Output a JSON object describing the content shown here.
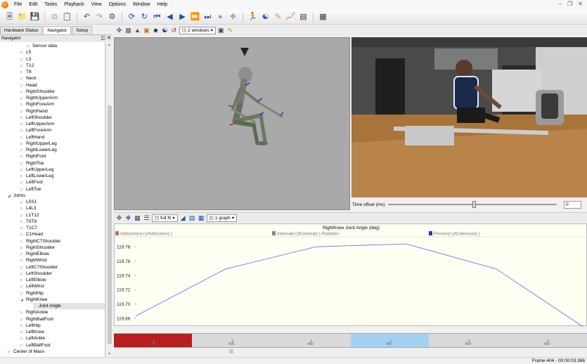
{
  "menu": [
    "File",
    "Edit",
    "Tasks",
    "Playback",
    "View",
    "Options",
    "Window",
    "Help"
  ],
  "left_tabs": [
    "Hardware Status",
    "Navigator",
    "Setup"
  ],
  "navigator_title": "Navigator",
  "tree": [
    {
      "label": "Sensor data",
      "indent": 4,
      "toggle": "▷"
    },
    {
      "label": "L5",
      "indent": 3,
      "toggle": "▷"
    },
    {
      "label": "L3",
      "indent": 3,
      "toggle": "▷"
    },
    {
      "label": "T12",
      "indent": 3,
      "toggle": "▷"
    },
    {
      "label": "T8",
      "indent": 3,
      "toggle": "▷"
    },
    {
      "label": "Neck",
      "indent": 3,
      "toggle": "▷"
    },
    {
      "label": "Head",
      "indent": 3,
      "toggle": "▷"
    },
    {
      "label": "RightShoulder",
      "indent": 3,
      "toggle": "▷"
    },
    {
      "label": "RightUpperArm",
      "indent": 3,
      "toggle": "▷"
    },
    {
      "label": "RightForeArm",
      "indent": 3,
      "toggle": "▷"
    },
    {
      "label": "RightHand",
      "indent": 3,
      "toggle": "▷"
    },
    {
      "label": "LeftShoulder",
      "indent": 3,
      "toggle": "▷"
    },
    {
      "label": "LeftUpperArm",
      "indent": 3,
      "toggle": "▷"
    },
    {
      "label": "LeftForeArm",
      "indent": 3,
      "toggle": "▷"
    },
    {
      "label": "LeftHand",
      "indent": 3,
      "toggle": "▷"
    },
    {
      "label": "RightUpperLeg",
      "indent": 3,
      "toggle": "▷"
    },
    {
      "label": "RightLowerLeg",
      "indent": 3,
      "toggle": "▷"
    },
    {
      "label": "RightFoot",
      "indent": 3,
      "toggle": "▷"
    },
    {
      "label": "RightToe",
      "indent": 3,
      "toggle": "▷"
    },
    {
      "label": "LeftUpperLeg",
      "indent": 3,
      "toggle": "▷"
    },
    {
      "label": "LeftLowerLeg",
      "indent": 3,
      "toggle": "▷"
    },
    {
      "label": "LeftFoot",
      "indent": 3,
      "toggle": "▷"
    },
    {
      "label": "LeftToe",
      "indent": 3,
      "toggle": "▷"
    },
    {
      "label": "Joints",
      "indent": 1,
      "toggle": "◢"
    },
    {
      "label": "L5S1",
      "indent": 3,
      "toggle": "▷"
    },
    {
      "label": "L4L3",
      "indent": 3,
      "toggle": "▷"
    },
    {
      "label": "L1T12",
      "indent": 3,
      "toggle": "▷"
    },
    {
      "label": "T9T8",
      "indent": 3,
      "toggle": "▷"
    },
    {
      "label": "T1C7",
      "indent": 3,
      "toggle": "▷"
    },
    {
      "label": "C1Head",
      "indent": 3,
      "toggle": "▷"
    },
    {
      "label": "RightC7Shoulder",
      "indent": 3,
      "toggle": "▷"
    },
    {
      "label": "RightShoulder",
      "indent": 3,
      "toggle": "▷"
    },
    {
      "label": "RightElbow",
      "indent": 3,
      "toggle": "▷"
    },
    {
      "label": "RightWrist",
      "indent": 3,
      "toggle": "▷"
    },
    {
      "label": "LeftC7Shoulder",
      "indent": 3,
      "toggle": "▷"
    },
    {
      "label": "LeftShoulder",
      "indent": 3,
      "toggle": "▷"
    },
    {
      "label": "LeftElbow",
      "indent": 3,
      "toggle": "▷"
    },
    {
      "label": "LeftWrist",
      "indent": 3,
      "toggle": "▷"
    },
    {
      "label": "RightHip",
      "indent": 3,
      "toggle": "▷"
    },
    {
      "label": "RightKnee",
      "indent": 3,
      "toggle": "◢"
    },
    {
      "label": "Joint Angle",
      "indent": 5,
      "toggle": "",
      "selected": true
    },
    {
      "label": "RightAnkle",
      "indent": 3,
      "toggle": "▷"
    },
    {
      "label": "RightBallFoot",
      "indent": 3,
      "toggle": "▷"
    },
    {
      "label": "LeftHip",
      "indent": 3,
      "toggle": "▷"
    },
    {
      "label": "LeftKnee",
      "indent": 3,
      "toggle": "▷"
    },
    {
      "label": "LeftAnkle",
      "indent": 3,
      "toggle": "▷"
    },
    {
      "label": "LeftBallFoot",
      "indent": 3,
      "toggle": "▷"
    },
    {
      "label": "Center of Mass",
      "indent": 1,
      "toggle": "▷"
    }
  ],
  "view_toolbar": {
    "windows_dropdown": "2 windows"
  },
  "video": {
    "time_offset_label": "Time offset (ms)",
    "time_offset_value": "0"
  },
  "graph_toolbar": {
    "fit_dropdown": "full fit",
    "graph_count_dropdown": "1 graph"
  },
  "chart_data": {
    "type": "line",
    "title": "RightKnee Joint Angle (deg)",
    "legend": [
      {
        "name": "Abduction(+)/Adduction(-)",
        "color": "#c06a6a"
      },
      {
        "name": "Internal(+)/External(-) Rotation",
        "color": "#6a9a6a"
      },
      {
        "name": "Flexion(+)/Extension(-)",
        "color": "#3030c0"
      }
    ],
    "y_ticks": [
      "119.78",
      "119.76",
      "119.74",
      "119.72",
      "119.70",
      "119.68"
    ],
    "ylim": [
      119.67,
      119.79
    ],
    "xlim": [
      0,
      1
    ],
    "series": [
      {
        "name": "Flexion(+)/Extension(-)",
        "color": "#6666dd",
        "x": [
          0,
          0.2,
          0.4,
          0.6,
          0.8,
          1.0
        ],
        "y": [
          119.683,
          119.749,
          119.78,
          119.784,
          119.749,
          119.665
        ]
      }
    ]
  },
  "timeline": {
    "ticks": [
      "403",
      "404",
      "405",
      "406",
      "407",
      "408",
      "409"
    ],
    "red_color": "#b81e1e",
    "blue_color": "#a3d1f2"
  },
  "status": {
    "frame_text": "Frame 404 - 00:00:03.366"
  }
}
